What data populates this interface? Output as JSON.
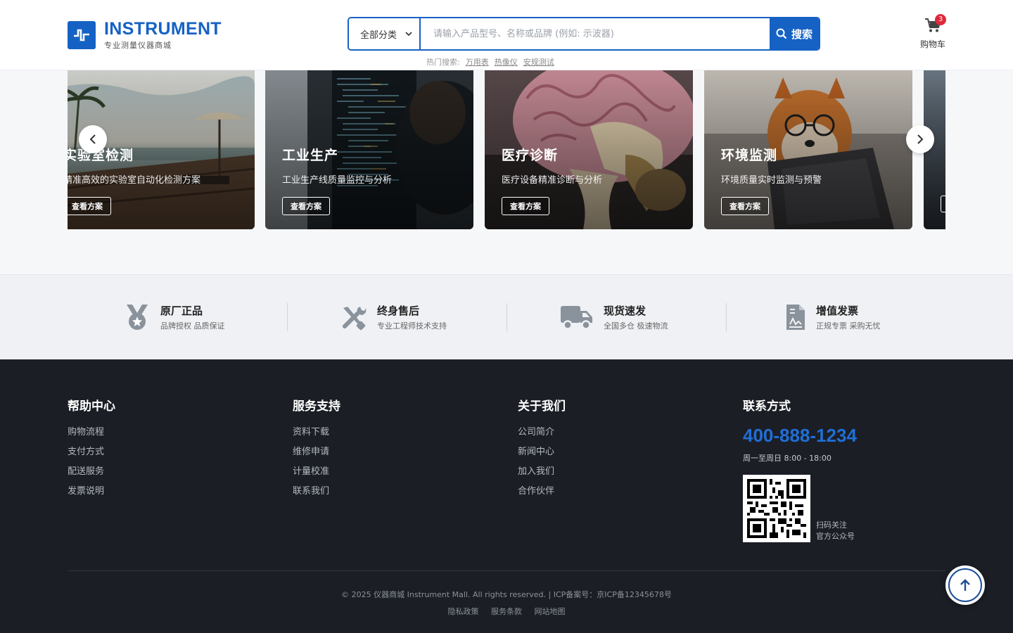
{
  "header": {
    "logo_title": "INSTRUMENT",
    "logo_subtitle": "专业测量仪器商城",
    "search": {
      "category": "全部分类",
      "placeholder": "请输入产品型号、名称或品牌 (例如: 示波器)",
      "button": "搜索"
    },
    "hot": {
      "label": "热门搜索:",
      "terms": [
        "万用表",
        "热像仪",
        "安规测试"
      ]
    },
    "cart": {
      "label": "购物车",
      "count": "3"
    }
  },
  "carousel": {
    "cards": [
      {
        "title": "实验室检测",
        "desc": "精准高效的实验室自动化检测方案",
        "button": "查看方案",
        "image": "beach-pool-scene"
      },
      {
        "title": "工业生产",
        "desc": "工业生产线质量监控与分析",
        "button": "查看方案",
        "image": "developer-screen-scene"
      },
      {
        "title": "医疗诊断",
        "desc": "医疗设备精准诊断与分析",
        "button": "查看方案",
        "image": "brain-model-scene"
      },
      {
        "title": "环境监测",
        "desc": "环境质量实时监测与预警",
        "button": "查看方案",
        "image": "dog-laptop-scene"
      }
    ]
  },
  "features": [
    {
      "title": "原厂正品",
      "sub": "品牌授权 品质保证",
      "icon": "medal-icon"
    },
    {
      "title": "终身售后",
      "sub": "专业工程师技术支持",
      "icon": "tools-icon"
    },
    {
      "title": "现货速发",
      "sub": "全国多仓 极速物流",
      "icon": "truck-icon"
    },
    {
      "title": "增值发票",
      "sub": "正规专票 采购无忧",
      "icon": "invoice-icon"
    }
  ],
  "footer": {
    "help": {
      "title": "帮助中心",
      "links": [
        "购物流程",
        "支付方式",
        "配送服务",
        "发票说明"
      ]
    },
    "service": {
      "title": "服务支持",
      "links": [
        "资料下载",
        "维修申请",
        "计量校准",
        "联系我们"
      ]
    },
    "about": {
      "title": "关于我们",
      "links": [
        "公司简介",
        "新闻中心",
        "加入我们",
        "合作伙伴"
      ]
    },
    "contact": {
      "title": "联系方式",
      "phone": "400-888-1234",
      "hours": "周一至周日 8:00 - 18:00",
      "qr_line1": "扫码关注",
      "qr_line2": "官方公众号"
    },
    "copyright": "© 2025 仪器商城 Instrument Mall. All rights reserved. | ICP备案号：京ICP备12345678号",
    "bottom_links": [
      "隐私政策",
      "服务条款",
      "网站地图"
    ]
  },
  "colors": {
    "brand": "#1662c4",
    "footer_bg": "#1b1e25",
    "badge": "#e0283b"
  }
}
